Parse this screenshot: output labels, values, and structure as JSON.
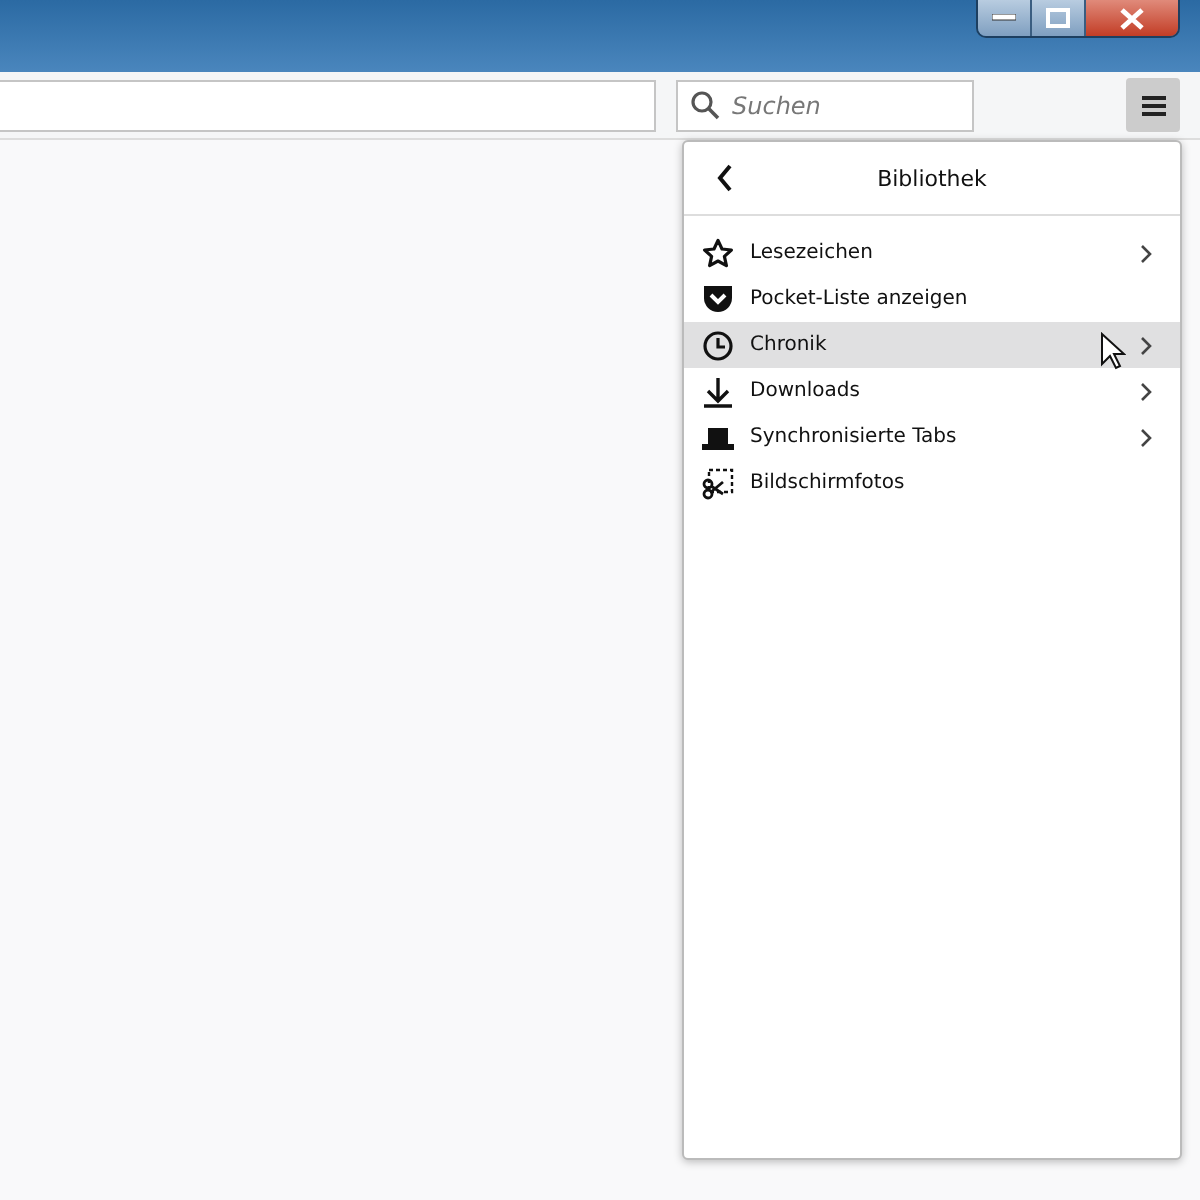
{
  "toolbar": {
    "search": {
      "placeholder": "Suchen"
    }
  },
  "panel": {
    "title": "Bibliothek",
    "items": [
      {
        "kind": "bookmarks",
        "label": "Lesezeichen",
        "submenu": true,
        "selected": false
      },
      {
        "kind": "pocket",
        "label": "Pocket-Liste anzeigen",
        "submenu": false,
        "selected": false
      },
      {
        "kind": "history",
        "label": "Chronik",
        "submenu": true,
        "selected": true
      },
      {
        "kind": "downloads",
        "label": "Downloads",
        "submenu": true,
        "selected": false
      },
      {
        "kind": "synced",
        "label": "Synchronisierte Tabs",
        "submenu": true,
        "selected": false
      },
      {
        "kind": "screenshots",
        "label": "Bildschirmfotos",
        "submenu": false,
        "selected": false
      }
    ]
  }
}
